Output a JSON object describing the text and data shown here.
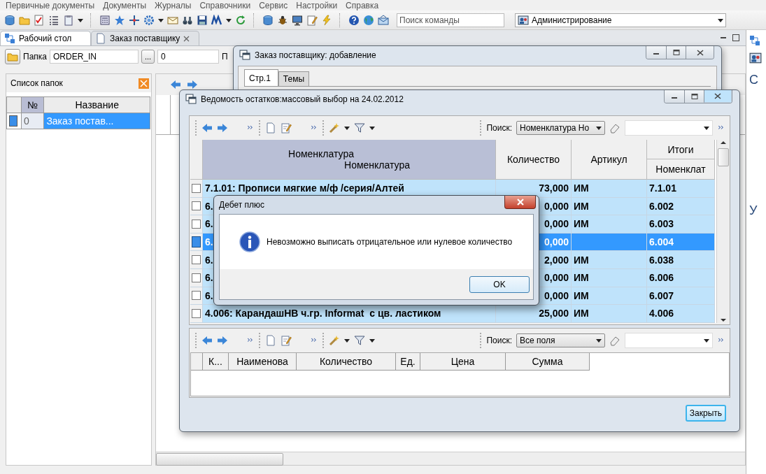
{
  "menu": [
    "Первичные документы",
    "Документы",
    "Журналы",
    "Справочники",
    "Сервис",
    "Настройки",
    "Справка"
  ],
  "command_search": {
    "placeholder": "Поиск команды"
  },
  "role_selector": {
    "value": "Администрирование"
  },
  "tabs": [
    {
      "label": "Рабочий стол",
      "selected": true,
      "closable": false
    },
    {
      "label": "Заказ поставщику",
      "selected": false,
      "closable": true
    }
  ],
  "folder_bar": {
    "label": "Папка",
    "folder": "ORDER_IN",
    "browse": "...",
    "number": "0",
    "label_2": "П"
  },
  "folder_list": {
    "title": "Список папок",
    "columns": [
      {
        "label": "№",
        "sorted": true
      },
      {
        "label": "Название",
        "sorted": false
      }
    ],
    "rows": [
      {
        "number": "0",
        "name": "Заказ постав...",
        "selected": true
      }
    ]
  },
  "right_panel": {
    "texts": [
      "С",
      "У"
    ]
  },
  "order_window": {
    "title": "Заказ поставщику: добавление",
    "tabs": [
      {
        "label": "Стр.1",
        "selected": true
      },
      {
        "label": "Темы",
        "selected": false
      }
    ]
  },
  "stock_window": {
    "title": "Ведомость остатков:массовый выбор на 24.02.2012",
    "top_grid": {
      "search_label": "Поиск:",
      "search_mode": "Номенклатура Но",
      "name_header": [
        "Номенклатура",
        "Номенклатура"
      ],
      "quantity_header": "Количество",
      "article_header": "Артикул",
      "totals_header": "Итоги",
      "totals_subheader": "Номенклат",
      "rows": [
        {
          "name": "7.1.01: Прописи мягкие м/ф /серия/Алтей",
          "quantity": "73,000",
          "article": "ИМ",
          "code": "7.1.01",
          "selected": false
        },
        {
          "name": "6.",
          "quantity": "0,000",
          "article": "ИМ",
          "code": "6.002",
          "selected": false
        },
        {
          "name": "6.",
          "quantity": "0,000",
          "article": "ИМ",
          "code": "6.003",
          "selected": false
        },
        {
          "name": "6.",
          "quantity": "0,000",
          "code": "6.004",
          "selected": true
        },
        {
          "name": "6.",
          "quantity": "2,000",
          "article": "ИМ",
          "code": "6.038",
          "selected": false
        },
        {
          "name": "6.",
          "quantity": "0,000",
          "article": "ИМ",
          "code": "6.006",
          "selected": false
        },
        {
          "name": "6.",
          "quantity": "0,000",
          "article": "ИМ",
          "code": "6.007",
          "selected": false
        },
        {
          "name": "4.006: КарандашНВ ч.гр. Informat  с цв. ластиком",
          "quantity": "25,000",
          "article": "ИМ",
          "code": "4.006",
          "selected": false
        }
      ]
    },
    "bottom_grid": {
      "search_label": "Поиск:",
      "search_mode": "Все поля",
      "columns": [
        "К...",
        "Наименова",
        "Количество",
        "Ед.",
        "Цена",
        "Сумма"
      ]
    },
    "close_button": "Закрыть"
  },
  "dialog": {
    "title": "Дебет плюс",
    "message": "Невозможно выписать отрицательное или нулевое количество",
    "button": "OK"
  }
}
